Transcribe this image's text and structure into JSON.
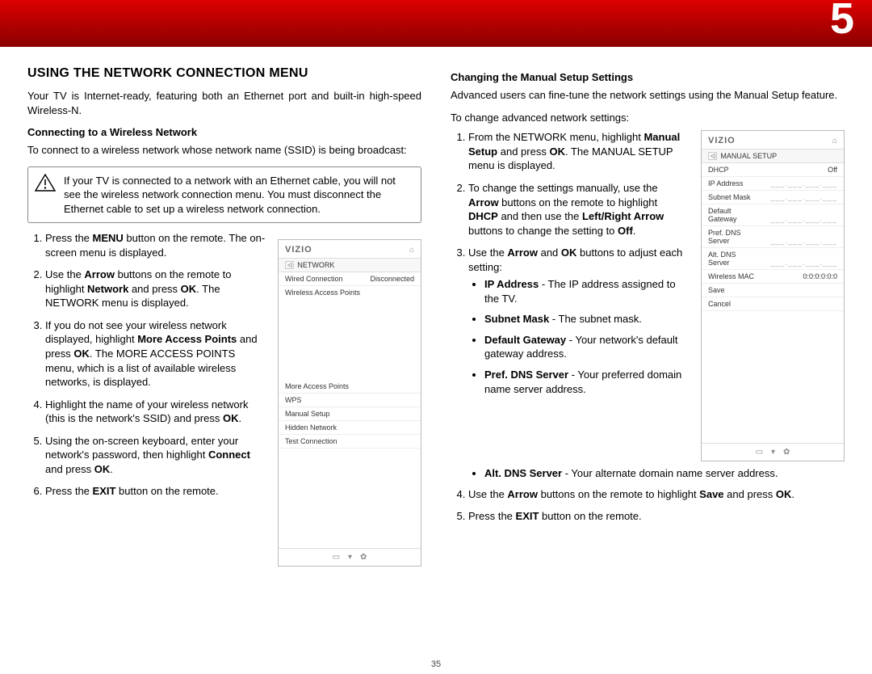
{
  "chapter_number": "5",
  "page_number": "35",
  "left": {
    "title": "USING THE NETWORK CONNECTION MENU",
    "intro": "Your TV is Internet-ready, featuring both an Ethernet port and built-in high-speed Wireless-N.",
    "sub1": "Connecting to a Wireless Network",
    "sub1_intro": "To connect to a wireless network whose network name (SSID) is being broadcast:",
    "warn": "If your TV is connected to a network with an Ethernet cable, you will not see the wireless network connection menu. You must disconnect the Ethernet cable to set up a wireless network connection.",
    "step1_a": "Press the ",
    "step1_b": "MENU",
    "step1_c": " button on the remote. The on-screen menu is displayed.",
    "step2_a": "Use the ",
    "step2_b": "Arrow",
    "step2_c": " buttons on the remote to highlight ",
    "step2_d": "Network",
    "step2_e": " and press ",
    "step2_f": "OK",
    "step2_g": ". The NETWORK menu is displayed.",
    "step3_a": "If you do not see your wireless network displayed, highlight ",
    "step3_b": "More Access Points",
    "step3_c": " and press ",
    "step3_d": "OK",
    "step3_e": ". The MORE ACCESS POINTS menu, which is a list of available wireless networks, is displayed.",
    "step4_a": "Highlight the name of your wireless network (this is the network's SSID) and press ",
    "step4_b": "OK",
    "step4_c": ".",
    "step5_a": "Using the on-screen keyboard, enter your network's password, then highlight ",
    "step5_b": "Connect",
    "step5_c": " and press ",
    "step5_d": "OK",
    "step5_e": ".",
    "step6_a": "Press the ",
    "step6_b": "EXIT",
    "step6_c": " button on the remote.",
    "menu1": {
      "brand": "VIZIO",
      "crumb": "NETWORK",
      "wired_label": "Wired Connection",
      "wired_value": "Disconnected",
      "wap": "Wireless Access Points",
      "more": "More Access Points",
      "wps": "WPS",
      "manual": "Manual Setup",
      "hidden": "Hidden Network",
      "test": "Test Connection"
    }
  },
  "right": {
    "sub": "Changing the Manual Setup Settings",
    "intro": "Advanced users can fine-tune the network settings using the Manual Setup feature.",
    "lead": "To change advanced network settings:",
    "s1_a": "From the NETWORK menu, highlight ",
    "s1_b": "Manual Setup",
    "s1_c": " and press ",
    "s1_d": "OK",
    "s1_e": ". The MANUAL SETUP menu is displayed.",
    "s2_a": "To change the settings manually, use the ",
    "s2_b": "Arrow",
    "s2_c": " buttons on the remote to highlight ",
    "s2_d": "DHCP",
    "s2_e": " and then use the ",
    "s2_f": "Left/Right Arrow",
    "s2_g": " buttons to change the setting to ",
    "s2_h": "Off",
    "s2_i": ".",
    "s3_a": "Use the ",
    "s3_b": "Arrow",
    "s3_c": " and ",
    "s3_d": "OK",
    "s3_e": " buttons to adjust each setting:",
    "b1_a": "IP Address",
    "b1_b": " - The IP address assigned to the TV.",
    "b2_a": "Subnet Mask",
    "b2_b": " - The subnet mask.",
    "b3_a": "Default Gateway",
    "b3_b": " - Your network's default gateway address.",
    "b4_a": "Pref. DNS Server",
    "b4_b": " - Your preferred domain name server address.",
    "b5_a": "Alt. DNS Server",
    "b5_b": " - Your alternate domain name server address.",
    "s4_a": "Use the ",
    "s4_b": "Arrow",
    "s4_c": " buttons on the remote to highlight ",
    "s4_d": "Save",
    "s4_e": " and press ",
    "s4_f": "OK",
    "s4_g": ".",
    "s5_a": "Press the ",
    "s5_b": "EXIT",
    "s5_c": " button on the remote.",
    "menu2": {
      "brand": "VIZIO",
      "crumb": "MANUAL SETUP",
      "dhcp_l": "DHCP",
      "dhcp_v": "Off",
      "ip": "IP Address",
      "mask": "Subnet Mask",
      "gw1": "Default",
      "gw2": "Gateway",
      "pdns1": "Pref. DNS",
      "pdns2": "Server",
      "adns1": "Alt. DNS",
      "adns2": "Server",
      "blank": "___.___.___.___",
      "mac_l": "Wireless MAC",
      "mac_v": "0:0:0:0:0:0",
      "save": "Save",
      "cancel": "Cancel"
    }
  }
}
